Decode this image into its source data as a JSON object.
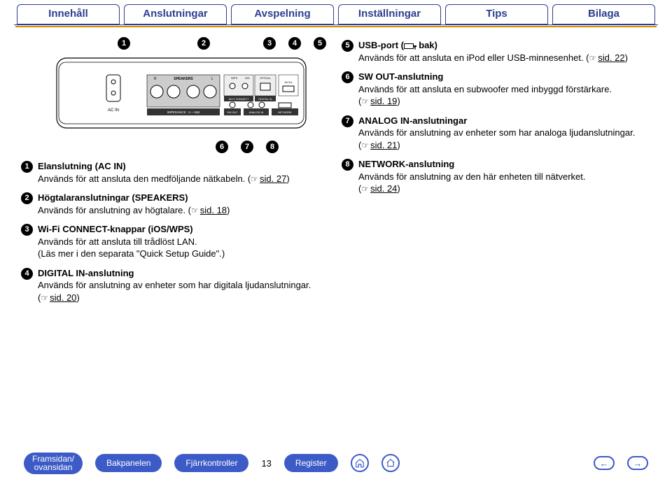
{
  "tabs": [
    "Innehåll",
    "Anslutningar",
    "Avspelning",
    "Inställningar",
    "Tips",
    "Bilaga"
  ],
  "diagram_labels": {
    "ac_in": "AC IN",
    "speakers": "SPEAKERS",
    "r": "R",
    "l": "L",
    "wps": "WPS",
    "ios": "iOS",
    "wifi": "Wi-Fi CONNECT",
    "digital_in": "DIGITAL IN",
    "optical": "OPTICAL",
    "svta": "5V/1A",
    "sw_out": "SW OUT",
    "analog_in": "ANALOG IN",
    "network": "NETWORK",
    "impedance": "IMPEDANCE : 4 ~ 16Ω"
  },
  "callouts_top": [
    "1",
    "2",
    "3",
    "4",
    "5"
  ],
  "callouts_bottom": [
    "6",
    "7",
    "8"
  ],
  "left": [
    {
      "n": "1",
      "title": "Elanslutning (AC IN)",
      "desc": "Används för att ansluta den medföljande nätkabeln. (",
      "link": "sid. 27",
      "after": ")"
    },
    {
      "n": "2",
      "title": "Högtalaranslutningar (SPEAKERS)",
      "desc": "Används för anslutning av högtalare. (",
      "link": "sid. 18",
      "after": ")"
    },
    {
      "n": "3",
      "title": "Wi-Fi CONNECT-knappar (iOS/WPS)",
      "desc": "Används för att ansluta till trådlöst LAN.",
      "extra": "(Läs mer i den separata \"Quick Setup Guide\".)"
    },
    {
      "n": "4",
      "title": "DIGITAL IN-anslutning",
      "desc": "Används för anslutning av enheter som har digitala ljudanslutningar.",
      "link_block": "sid. 20"
    }
  ],
  "right": [
    {
      "n": "5",
      "title_pre": "USB-port (",
      "title_post": ", bak)",
      "desc": "Används för att ansluta en iPod eller USB-minnesenhet. (",
      "link": "sid. 22",
      "after": ")"
    },
    {
      "n": "6",
      "title": "SW OUT-anslutning",
      "desc": "Används för att ansluta en subwoofer med inbyggd förstärkare.",
      "link_block": "sid. 19"
    },
    {
      "n": "7",
      "title": "ANALOG IN-anslutningar",
      "desc": "Används för anslutning av enheter som har analoga ljudanslutningar.",
      "link_block": "sid. 21"
    },
    {
      "n": "8",
      "title": "NETWORK-anslutning",
      "desc": "Används för anslutning av den här enheten till nätverket.",
      "link_block": "sid. 24"
    }
  ],
  "footer": {
    "front": "Framsidan/\novansidan",
    "back": "Bakpanelen",
    "remote": "Fjärrkontroller",
    "register": "Register",
    "page": "13"
  }
}
